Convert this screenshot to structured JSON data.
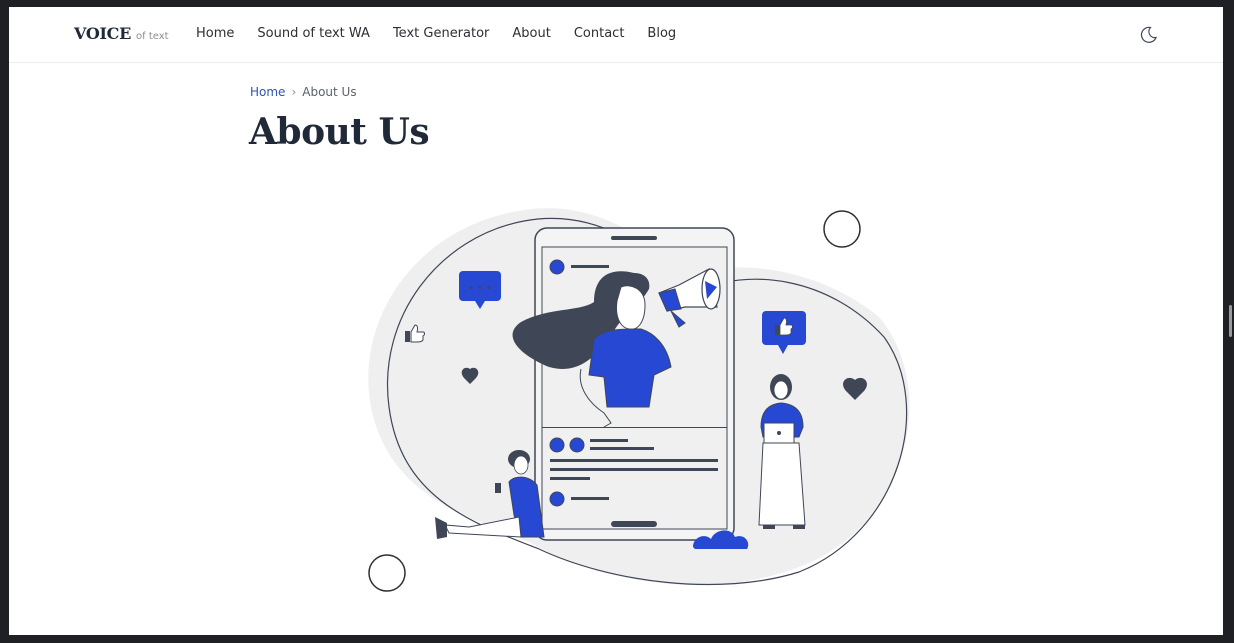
{
  "brand": {
    "name": "VOICE",
    "tagline": "of text"
  },
  "nav": {
    "items": [
      {
        "label": "Home"
      },
      {
        "label": "Sound of text WA"
      },
      {
        "label": "Text Generator"
      },
      {
        "label": "About"
      },
      {
        "label": "Contact"
      },
      {
        "label": "Blog"
      }
    ],
    "theme_toggle_icon": "moon-icon"
  },
  "breadcrumb": {
    "home": "Home",
    "separator": "›",
    "current": "About Us"
  },
  "page": {
    "title": "About Us"
  },
  "hero": {
    "description_icon": "social-media-megaphone-illustration",
    "speech_bubble_text": "• • •"
  },
  "colors": {
    "accent": "#2748d2",
    "dark": "#3f4656",
    "blob": "#efefef",
    "text": "#1f2937",
    "link": "#2f52b8"
  }
}
